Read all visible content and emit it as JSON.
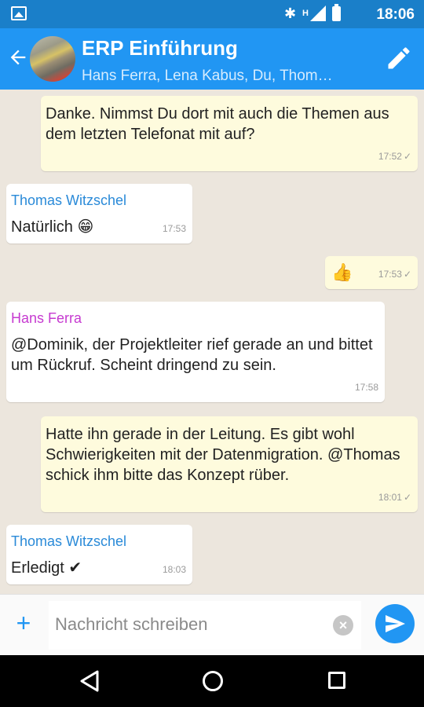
{
  "status_bar": {
    "time": "18:06",
    "network": "H"
  },
  "header": {
    "title": "ERP Einführung",
    "subtitle": "Hans Ferra, Lena Kabus, Du, Thom…"
  },
  "messages": [
    {
      "direction": "out",
      "text": "Danke. Nimmst Du dort mit auch die Themen aus dem letzten Telefonat mit auf?",
      "time": "17:52",
      "check": "✓"
    },
    {
      "direction": "in",
      "sender": "Thomas Witzschel",
      "sender_color": "#2a8ad8",
      "text": "Natürlich 😁",
      "time": "17:53"
    },
    {
      "direction": "out",
      "text": "👍",
      "time": "17:53",
      "check": "✓"
    },
    {
      "direction": "in",
      "sender": "Hans Ferra",
      "sender_color": "#c63ad0",
      "text": "@Dominik, der Projektleiter rief gerade an und bittet um Rückruf. Scheint dringend zu sein.",
      "time": "17:58"
    },
    {
      "direction": "out",
      "text": "Hatte ihn gerade in der Leitung. Es gibt wohl Schwierigkeiten mit der Datenmigration. @Thomas schick ihm bitte das Konzept rüber.",
      "time": "18:01",
      "check": "✓"
    },
    {
      "direction": "in",
      "sender": "Thomas Witzschel",
      "sender_color": "#2a8ad8",
      "text": "Erledigt ✔",
      "time": "18:03"
    }
  ],
  "composer": {
    "placeholder": "Nachricht schreiben",
    "value": ""
  },
  "colors": {
    "accent": "#2196f3",
    "status_bar": "#1a7fc9",
    "incoming_bubble": "#ffffff",
    "outgoing_bubble": "#fefbdd",
    "background": "#ece6dd"
  }
}
